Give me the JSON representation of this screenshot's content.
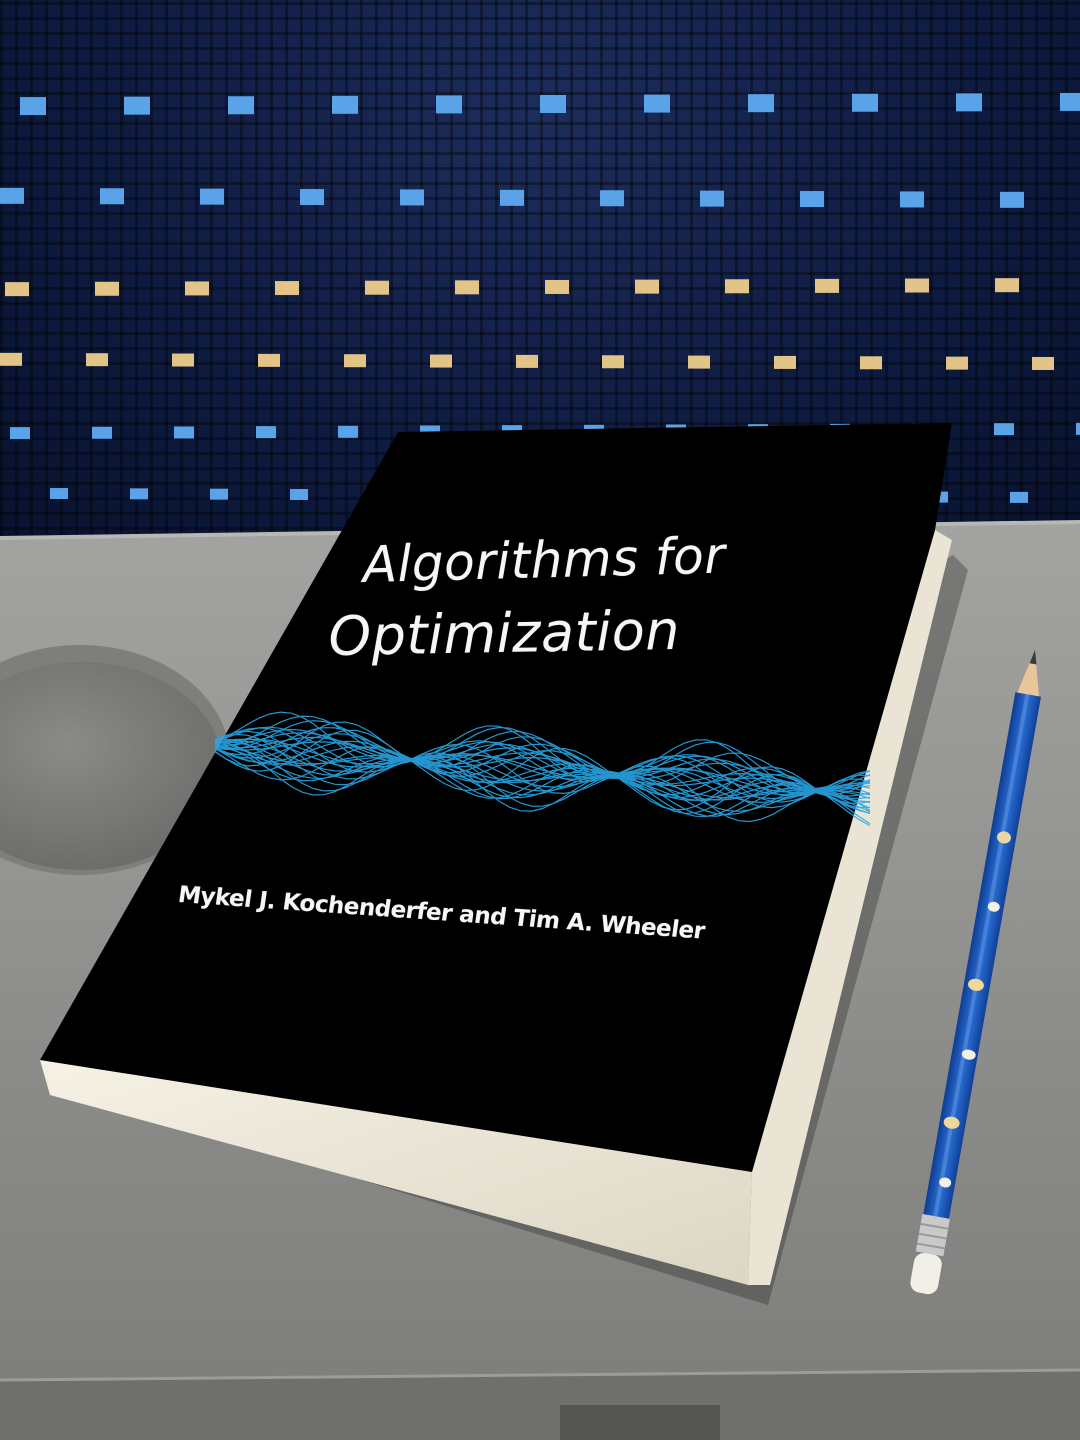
{
  "book": {
    "title_line1": "Algorithms for",
    "title_line2": "Optimization",
    "authors": "Mykel J. Kochenderfer and Tim A. Wheeler"
  },
  "colors": {
    "seat_fabric": "#13214a",
    "seat_dot_blue": "#5aa3e8",
    "seat_dot_gold": "#e3c487",
    "tray": "#8d8d8b",
    "book_cover": "#000000",
    "wave": "#2aa6e6",
    "pages": "#f1ede0",
    "pencil": "#1f5fc4"
  }
}
